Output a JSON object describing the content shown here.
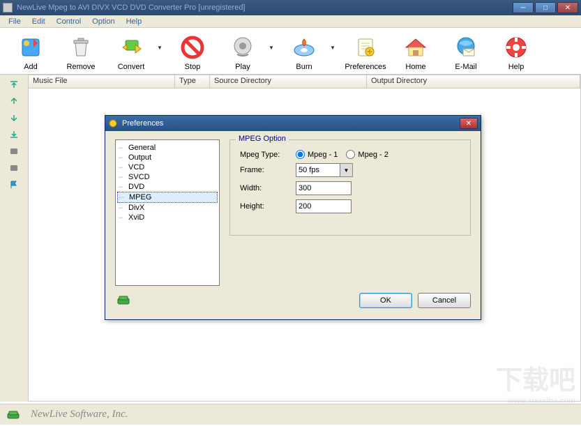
{
  "title": "NewLive Mpeg to AVI DIVX VCD DVD Converter Pro  [unregistered]",
  "menubar": [
    "File",
    "Edit",
    "Control",
    "Option",
    "Help"
  ],
  "toolbar": [
    {
      "name": "add",
      "label": "Add",
      "drop": false
    },
    {
      "name": "remove",
      "label": "Remove",
      "drop": false
    },
    {
      "name": "convert",
      "label": "Convert",
      "drop": true
    },
    {
      "name": "stop",
      "label": "Stop",
      "drop": false
    },
    {
      "name": "play",
      "label": "Play",
      "drop": true
    },
    {
      "name": "burn",
      "label": "Burn",
      "drop": true
    },
    {
      "name": "preferences",
      "label": "Preferences",
      "drop": false
    },
    {
      "name": "home",
      "label": "Home",
      "drop": false
    },
    {
      "name": "email",
      "label": "E-Mail",
      "drop": false
    },
    {
      "name": "help",
      "label": "Help",
      "drop": false
    }
  ],
  "columns": {
    "c1": "Music File",
    "c2": "Type",
    "c3": "Source Directory",
    "c4": "Output Directory"
  },
  "dialog": {
    "title": "Preferences",
    "tree": [
      "General",
      "Output",
      "VCD",
      "SVCD",
      "DVD",
      "MPEG",
      "DivX",
      "XviD"
    ],
    "selected": "MPEG",
    "panel_title": "MPEG Option",
    "type_label": "Mpeg Type:",
    "type_opt1": "Mpeg - 1",
    "type_opt2": "Mpeg - 2",
    "frame_label": "Frame:",
    "frame_value": "50 fps",
    "width_label": "Width:",
    "width_value": "300",
    "height_label": "Height:",
    "height_value": "200",
    "ok": "OK",
    "cancel": "Cancel"
  },
  "footer": "NewLive Software, Inc.",
  "watermark": "下载吧",
  "watermark_sub": "www.xiazaiba.com"
}
